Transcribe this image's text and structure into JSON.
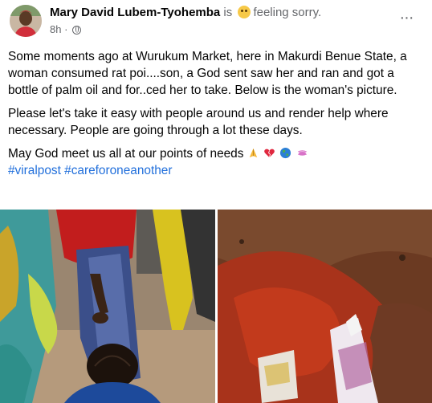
{
  "post": {
    "author": "Mary David Lubem-Tyohemba",
    "is_text": " is",
    "feeling": "feeling sorry.",
    "time": "8h",
    "separator": "·",
    "more": "···",
    "paragraphs": [
      "Some moments ago at Wurukum Market, here in Makurdi Benue State, a woman consumed rat poi....son,  a God sent saw her and ran and got a bottle of palm oil and for..ced her to take. Below is the woman's picture.",
      "Please let's take it easy with people around us and render help where necessary. People are going through a lot these days.",
      "May God meet us all at our points of needs"
    ],
    "hashtags": "#viralpost #careforoneanother"
  },
  "icons": [
    "sad-emoji-icon",
    "globe-icon",
    "more-icon",
    "folded-hands-emoji-icon",
    "broken-heart-emoji-icon",
    "globe-emoji-icon",
    "ribbon-emoji-icon"
  ],
  "colors": {
    "link": "#216fdb",
    "secondary_text": "#65676b",
    "text": "#050505"
  }
}
